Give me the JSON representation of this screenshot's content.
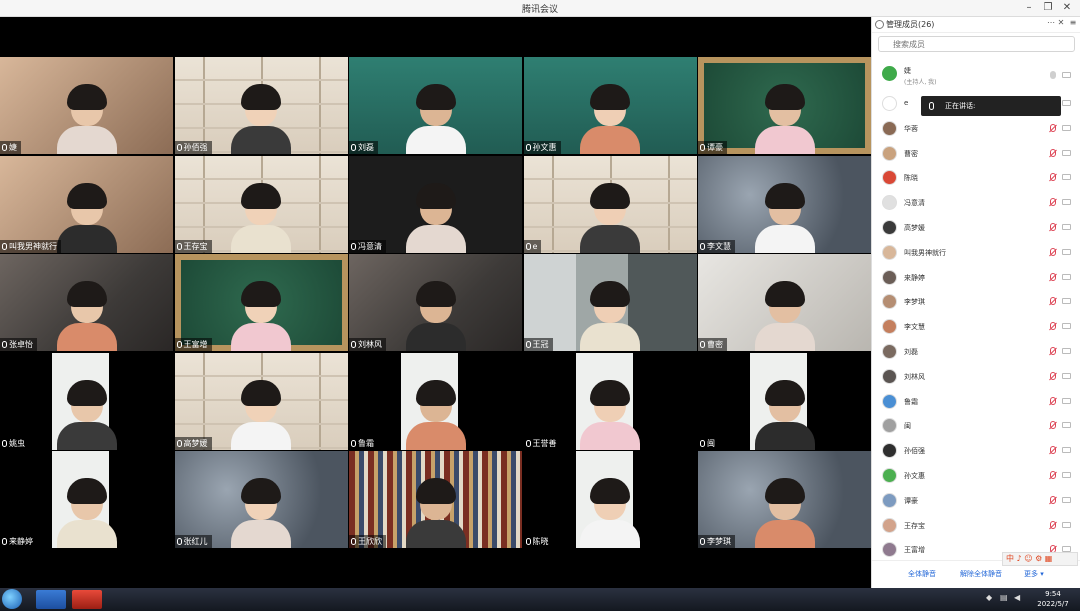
{
  "window": {
    "title": "腾讯会议"
  },
  "tiles": [
    {
      "name": "婕",
      "bg": "bg-warm"
    },
    {
      "name": "孙佰强",
      "bg": "bg-shelf"
    },
    {
      "name": "刘磊",
      "bg": "bg-teal"
    },
    {
      "name": "孙文惠",
      "bg": "bg-teal"
    },
    {
      "name": "谭豪",
      "bg": "bg-green"
    },
    {
      "name": "叫我男神就行",
      "bg": "bg-warm"
    },
    {
      "name": "王存宝",
      "bg": "bg-shelf"
    },
    {
      "name": "冯意清",
      "bg": "bg-dark"
    },
    {
      "name": "e",
      "bg": "bg-shelf"
    },
    {
      "name": "李文慧",
      "bg": "bg-blur"
    },
    {
      "name": "张卓怡",
      "bg": "bg-room"
    },
    {
      "name": "王富增",
      "bg": "bg-green"
    },
    {
      "name": "刘林风",
      "bg": "bg-room"
    },
    {
      "name": "王冠",
      "bg": "bg-office"
    },
    {
      "name": "曹密",
      "bg": "bg-light"
    },
    {
      "name": "姚虫",
      "bg": "bg-window"
    },
    {
      "name": "高梦媛",
      "bg": "bg-shelf"
    },
    {
      "name": "鲁霜",
      "bg": "bg-window"
    },
    {
      "name": "王誉善",
      "bg": "bg-window"
    },
    {
      "name": "闽",
      "bg": "bg-window"
    },
    {
      "name": "来静婷",
      "bg": "bg-window"
    },
    {
      "name": "张红儿",
      "bg": "bg-blur"
    },
    {
      "name": "王欣欣",
      "bg": "bg-books"
    },
    {
      "name": "陈晓",
      "bg": "bg-window"
    },
    {
      "name": "李梦琪",
      "bg": "bg-blur"
    }
  ],
  "panel": {
    "title": "管理成员(26)",
    "search_placeholder": "搜索成员",
    "host": {
      "name": "婕",
      "role": "(主持人, 我)"
    },
    "members": [
      "e",
      "华蓉",
      "曹密",
      "陈晓",
      "冯意清",
      "高梦媛",
      "叫我男神就行",
      "来静婷",
      "李梦琪",
      "李文慧",
      "刘磊",
      "刘林风",
      "鲁霜",
      "闽",
      "孙佰强",
      "孙文惠",
      "谭豪",
      "王存宝",
      "王富增"
    ],
    "speaking_label": "正在讲话:",
    "mute_all": "全体静音",
    "unmute_all": "解除全体静音",
    "more": "更多 ▾"
  },
  "ime": {
    "label": "中 ♪ ☺ ⚙ ▦"
  },
  "taskbar": {
    "time": "9:54",
    "date": "2022/5/7"
  },
  "colors": {
    "accent": "#2468d8",
    "mic_off": "#dd4455"
  }
}
